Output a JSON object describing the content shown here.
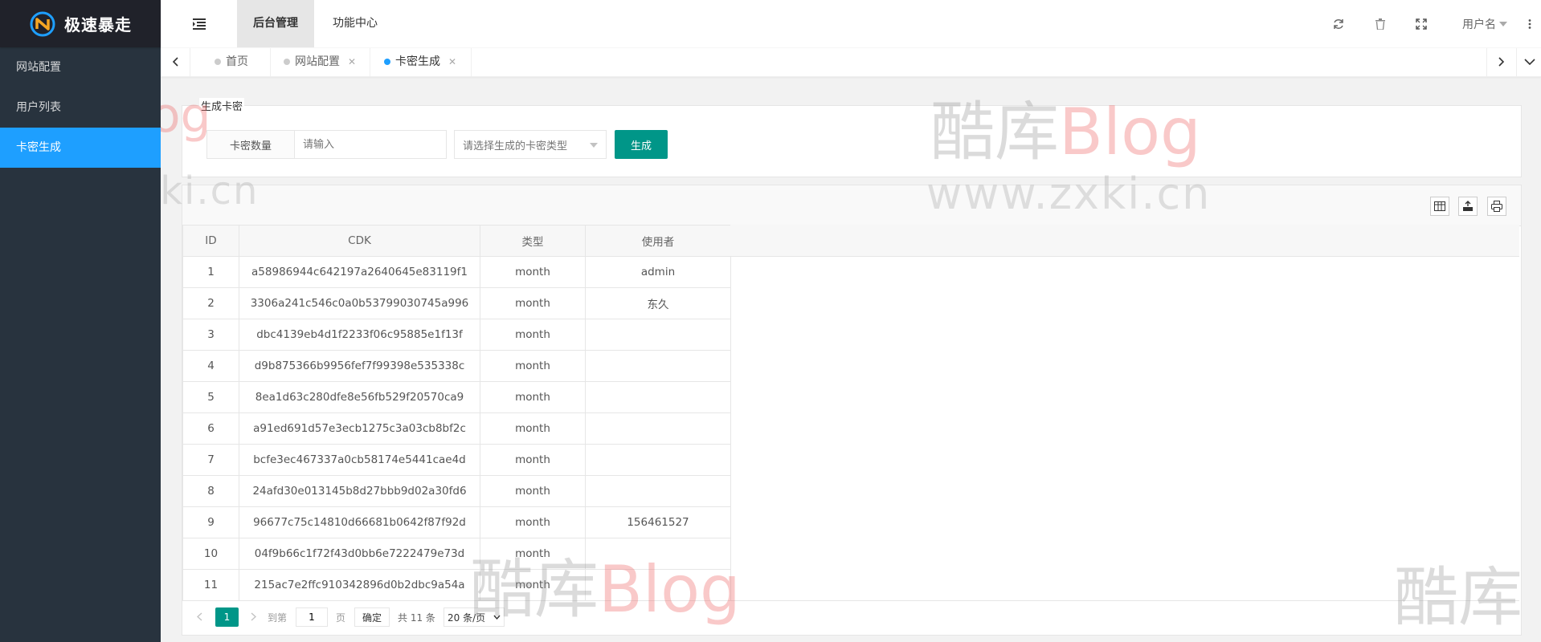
{
  "app": {
    "logo_text": "极速暴走"
  },
  "sidebar": {
    "items": [
      {
        "label": "网站配置"
      },
      {
        "label": "用户列表"
      },
      {
        "label": "卡密生成"
      }
    ]
  },
  "header": {
    "tabs": [
      {
        "label": "后台管理"
      },
      {
        "label": "功能中心"
      }
    ],
    "username": "用户名"
  },
  "page_tabs": [
    {
      "label": "首页"
    },
    {
      "label": "网站配置"
    },
    {
      "label": "卡密生成"
    }
  ],
  "form": {
    "legend": "生成卡密",
    "count_label": "卡密数量",
    "count_placeholder": "请输入",
    "type_placeholder": "请选择生成的卡密类型",
    "submit_label": "生成"
  },
  "table": {
    "columns": [
      "ID",
      "CDK",
      "类型",
      "使用者"
    ],
    "rows": [
      [
        "1",
        "a58986944c642197a2640645e83119f1",
        "month",
        "admin"
      ],
      [
        "2",
        "3306a241c546c0a0b53799030745a996",
        "month",
        "东久"
      ],
      [
        "3",
        "dbc4139eb4d1f2233f06c95885e1f13f",
        "month",
        ""
      ],
      [
        "4",
        "d9b875366b9956fef7f99398e535338c",
        "month",
        ""
      ],
      [
        "5",
        "8ea1d63c280dfe8e56fb529f20570ca9",
        "month",
        ""
      ],
      [
        "6",
        "a91ed691d57e3ecb1275c3a03cb8bf2c",
        "month",
        ""
      ],
      [
        "7",
        "bcfe3ec467337a0cb58174e5441cae4d",
        "month",
        ""
      ],
      [
        "8",
        "24afd30e013145b8d27bbb9d02a30fd6",
        "month",
        ""
      ],
      [
        "9",
        "96677c75c14810d66681b0642f87f92d",
        "month",
        "156461527"
      ],
      [
        "10",
        "04f9b66c1f72f43d0bb6e7222479e73d",
        "month",
        ""
      ],
      [
        "11",
        "215ac7e2ffc910342896d0b2dbc9a54a",
        "month",
        ""
      ]
    ]
  },
  "pager": {
    "current": "1",
    "goto_label": "到第",
    "goto_value": "1",
    "page_unit": "页",
    "confirm_label": "确定",
    "total_text": "共 11 条",
    "page_size": "20 条/页"
  },
  "watermark": {
    "text_cn": "酷库",
    "text_blog": "Blog",
    "url": "www.zxki.cn"
  },
  "colors": {
    "sidebar": "#28333e",
    "accent_blue": "#1e9fff",
    "button_green": "#009688"
  }
}
